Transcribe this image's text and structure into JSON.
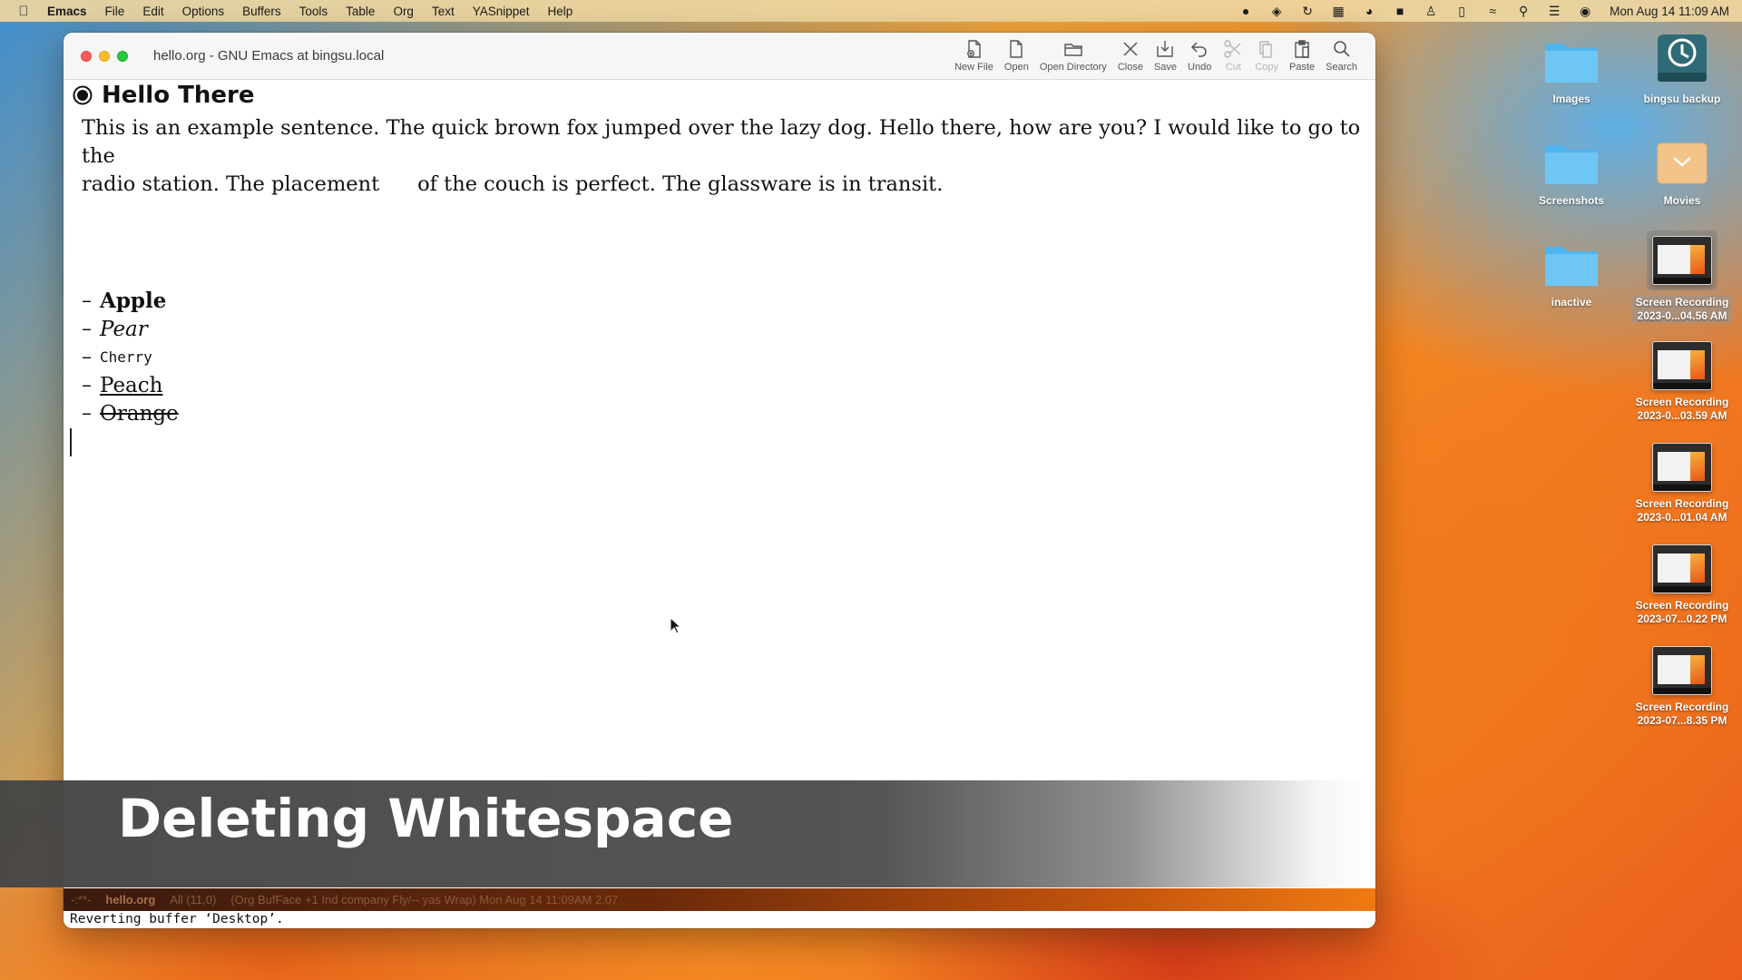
{
  "menubar": {
    "app_name": "Emacs",
    "items": [
      "File",
      "Edit",
      "Options",
      "Buffers",
      "Tools",
      "Table",
      "Org",
      "Text",
      "YASnippet",
      "Help"
    ],
    "clock": "Mon Aug 14  11:09 AM"
  },
  "window": {
    "title": "hello.org - GNU Emacs at bingsu.local",
    "toolbar": {
      "new_file": "New File",
      "open": "Open",
      "open_directory": "Open Directory",
      "close": "Close",
      "save": "Save",
      "undo": "Undo",
      "cut": "Cut",
      "copy": "Copy",
      "paste": "Paste",
      "search": "Search"
    }
  },
  "buffer": {
    "heading": "Hello There",
    "para_line1": "This is an example sentence. The quick brown fox jumped over the lazy dog. Hello there, how are you? I would like to go to the",
    "para_line2_a": "radio station. The placement",
    "para_line2_b": "of the couch is perfect. The glassware is in transit.",
    "list": [
      {
        "dash": "–",
        "text": "Apple"
      },
      {
        "dash": "–",
        "text": "Pear"
      },
      {
        "dash": "–",
        "text": "Cherry"
      },
      {
        "dash": "–",
        "text": "Peach"
      },
      {
        "dash": "–",
        "text": "Orange"
      }
    ]
  },
  "caption": "Deleting Whitespace",
  "modeline": {
    "status": "-:**-",
    "buffer_name": "hello.org",
    "position": "All (11,0)",
    "modes": "(Org BufFace +1 Ind company Fly/-- yas Wrap) Mon Aug 14 11:09AM 2.07"
  },
  "minibuffer": "Reverting buffer ‘Desktop’.",
  "desktop": {
    "icons": [
      {
        "label": "Images"
      },
      {
        "label": "bingsu backup"
      },
      {
        "label": "Screenshots"
      },
      {
        "label": "Movies"
      },
      {
        "label": "inactive"
      },
      {
        "label_line1": "Screen Recording",
        "label_line2": "2023-0...04.56 AM"
      },
      {
        "label_line1": "Screen Recording",
        "label_line2": "2023-0...03.59 AM"
      },
      {
        "label_line1": "Screen Recording",
        "label_line2": "2023-0...01.04 AM"
      },
      {
        "label_line1": "Screen Recording",
        "label_line2": "2023-07...0.22 PM"
      },
      {
        "label_line1": "Screen Recording",
        "label_line2": "2023-07...8.35 PM"
      }
    ]
  }
}
